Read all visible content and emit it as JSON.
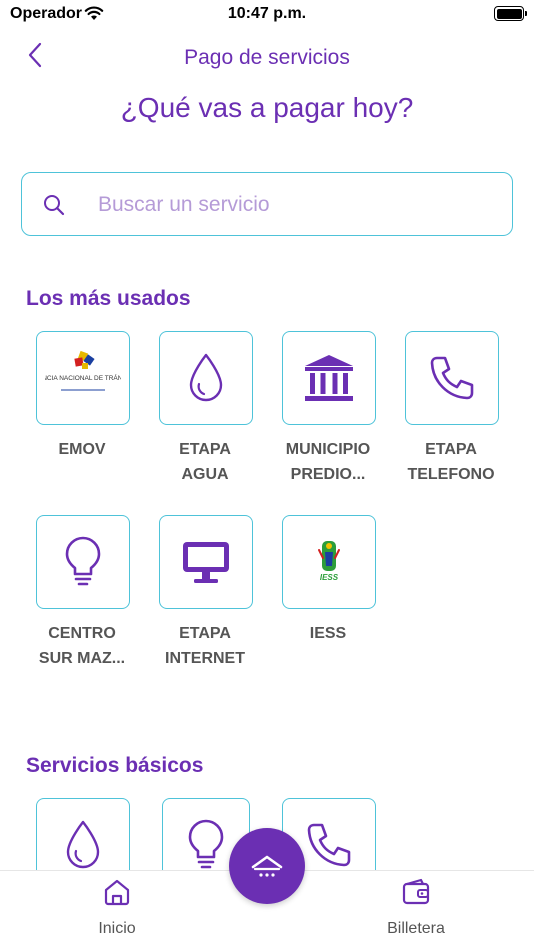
{
  "status_bar": {
    "carrier": "Operador",
    "time": "10:47 p.m."
  },
  "header": {
    "title": "Pago de servicios",
    "headline": "¿Qué vas a pagar hoy?"
  },
  "search": {
    "placeholder": "Buscar un servicio",
    "value": ""
  },
  "most_used": {
    "title": "Los más usados",
    "items": [
      {
        "label": "EMOV",
        "icon": "agencia-nacional-transito-logo",
        "logo_text": "AGENCIA NACIONAL DE TRÁNSITO"
      },
      {
        "label": "ETAPA\nAGUA",
        "icon": "water-drop-icon"
      },
      {
        "label": "MUNICIPIO\nPREDIO...",
        "icon": "government-building-icon"
      },
      {
        "label": "ETAPA\nTELEFONO",
        "icon": "phone-icon"
      },
      {
        "label": "CENTRO\nSUR MAZ...",
        "icon": "lightbulb-icon"
      },
      {
        "label": "ETAPA\nINTERNET",
        "icon": "monitor-icon"
      },
      {
        "label": "IESS",
        "icon": "iess-logo",
        "logo_text": "IESS"
      }
    ]
  },
  "basic_services": {
    "title": "Servicios básicos",
    "items": [
      {
        "icon": "water-drop-icon"
      },
      {
        "icon": "lightbulb-icon"
      },
      {
        "icon": "phone-icon"
      }
    ]
  },
  "tab_bar": {
    "items": [
      {
        "label": "Inicio",
        "icon": "home-icon"
      },
      {
        "label": "Billetera",
        "icon": "wallet-icon"
      }
    ],
    "fab_icon": "expand-up-icon"
  },
  "colors": {
    "accent": "#6b2fb3",
    "border": "#4ec3d9",
    "placeholder": "#b59bd7"
  }
}
